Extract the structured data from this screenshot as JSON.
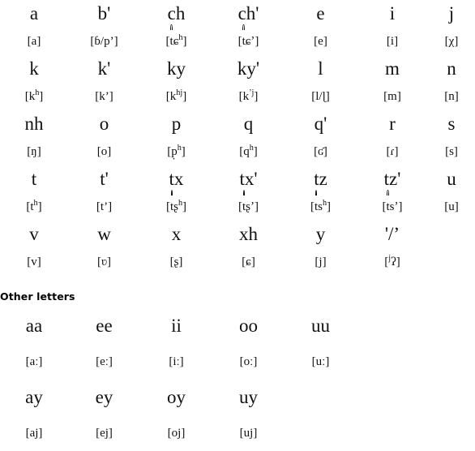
{
  "main_table": {
    "rows": [
      {
        "letters": [
          "a",
          "b'",
          "ch",
          "ch'",
          "e",
          "i",
          "j"
        ],
        "ipa_plain": [
          "[a]",
          "[ɓ/p’]",
          "[t͡ɕʰ]",
          "[t͡ɕ’]",
          "[e]",
          "[i]",
          "[χ]"
        ]
      },
      {
        "letters": [
          "k",
          "k'",
          "ky",
          "ky'",
          "l",
          "m",
          "n"
        ],
        "ipa_plain": [
          "[kʰ]",
          "[k’]",
          "[kʰʲ]",
          "[k’ʲ]",
          "[l/ɭ]",
          "[m]",
          "[n]"
        ]
      },
      {
        "letters": [
          "nh",
          "o",
          "p",
          "q",
          "q'",
          "r",
          "s"
        ],
        "ipa_plain": [
          "[ŋ]",
          "[o]",
          "[p̣ʰ]",
          "[qʰ]",
          "[ʛ]",
          "[ɾ]",
          "[s]"
        ]
      },
      {
        "letters": [
          "t",
          "t'",
          "tx",
          "tx'",
          "tz",
          "tz'",
          "u"
        ],
        "ipa_plain": [
          "[tʰ]",
          "[t’]",
          "[t͡ʂʰ]",
          "[t͡ʂ’]",
          "[t͡sʰ]",
          "[t͡s’]",
          "[u]"
        ]
      },
      {
        "letters": [
          "v",
          "w",
          "x",
          "xh",
          "y",
          "'/’",
          ""
        ],
        "ipa_plain": [
          "[v]",
          "[ʋ]",
          "[ʂ]",
          "[ɕ]",
          "[j]",
          "[ʲʔ]",
          ""
        ]
      }
    ]
  },
  "other_section": {
    "heading": "Other letters",
    "rows": [
      {
        "letters": [
          "aa",
          "ee",
          "ii",
          "oo",
          "uu",
          ""
        ],
        "ipa_plain": [
          "[aː]",
          "[eː]",
          "[iː]",
          "[oː]",
          "[uː]",
          ""
        ]
      },
      {
        "letters": [
          "ay",
          "ey",
          "oy",
          "uy",
          "",
          ""
        ],
        "ipa_plain": [
          "[aj]",
          "[ej]",
          "[oj]",
          "[uj]",
          "",
          ""
        ]
      }
    ]
  },
  "colors": {
    "text": "#111111",
    "background": "#ffffff",
    "heading": "#000000"
  }
}
